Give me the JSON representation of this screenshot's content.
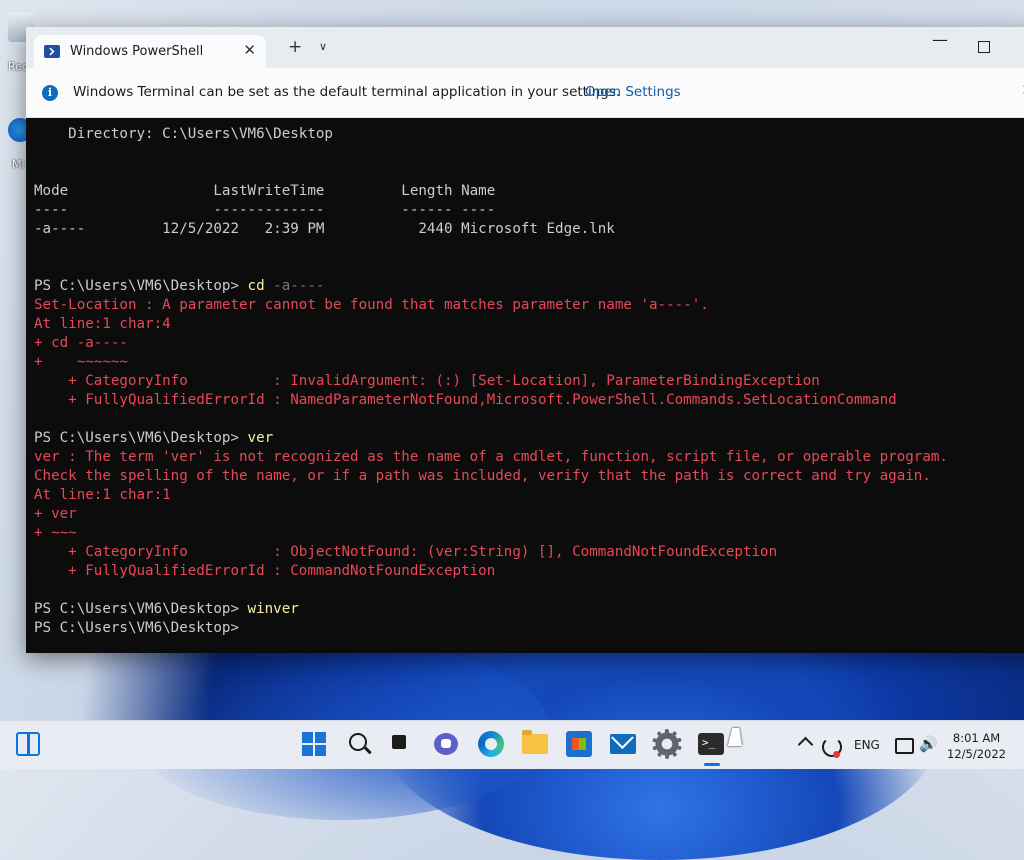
{
  "desktop": {
    "icons": [
      {
        "label": "Rec",
        "icon": "recycle-bin-icon"
      },
      {
        "label": "Mi",
        "icon": "edge-shortcut-icon"
      }
    ]
  },
  "window": {
    "tab_title": "Windows PowerShell",
    "tab_close": "✕",
    "new_tab": "+",
    "tab_dropdown": "∨",
    "minimize": "—",
    "close": "✕",
    "info_icon": "i",
    "info_text": "Windows Terminal can be set as the default terminal application in your settings.",
    "info_link": "Open Settings",
    "info_close": "✕"
  },
  "console": {
    "lines": [
      {
        "type": "out",
        "text": "    Directory: C:\\Users\\VM6\\Desktop"
      },
      {
        "type": "out",
        "text": ""
      },
      {
        "type": "out",
        "text": ""
      },
      {
        "type": "out",
        "text": "Mode                 LastWriteTime         Length Name"
      },
      {
        "type": "out",
        "text": "----                 -------------         ------ ----"
      },
      {
        "type": "out",
        "text": "-a----         12/5/2022   2:39 PM           2440 Microsoft Edge.lnk"
      },
      {
        "type": "out",
        "text": ""
      },
      {
        "type": "out",
        "text": ""
      },
      {
        "type": "prompt",
        "prompt": "PS C:\\Users\\VM6\\Desktop> ",
        "cmd": "cd",
        "arg": " -a----"
      },
      {
        "type": "err",
        "text": "Set-Location : A parameter cannot be found that matches parameter name 'a----'."
      },
      {
        "type": "err",
        "text": "At line:1 char:4"
      },
      {
        "type": "err",
        "text": "+ cd -a----"
      },
      {
        "type": "err",
        "text": "+    ~~~~~~"
      },
      {
        "type": "err",
        "text": "    + CategoryInfo          : InvalidArgument: (:) [Set-Location], ParameterBindingException"
      },
      {
        "type": "err",
        "text": "    + FullyQualifiedErrorId : NamedParameterNotFound,Microsoft.PowerShell.Commands.SetLocationCommand"
      },
      {
        "type": "out",
        "text": ""
      },
      {
        "type": "prompt",
        "prompt": "PS C:\\Users\\VM6\\Desktop> ",
        "cmd": "ver",
        "arg": ""
      },
      {
        "type": "err",
        "text": "ver : The term 'ver' is not recognized as the name of a cmdlet, function, script file, or operable program."
      },
      {
        "type": "err",
        "text": "Check the spelling of the name, or if a path was included, verify that the path is correct and try again."
      },
      {
        "type": "err",
        "text": "At line:1 char:1"
      },
      {
        "type": "err",
        "text": "+ ver"
      },
      {
        "type": "err",
        "text": "+ ~~~"
      },
      {
        "type": "err",
        "text": "    + CategoryInfo          : ObjectNotFound: (ver:String) [], CommandNotFoundException"
      },
      {
        "type": "err",
        "text": "    + FullyQualifiedErrorId : CommandNotFoundException"
      },
      {
        "type": "out",
        "text": ""
      },
      {
        "type": "prompt",
        "prompt": "PS C:\\Users\\VM6\\Desktop> ",
        "cmd": "winver",
        "arg": ""
      },
      {
        "type": "prompt",
        "prompt": "PS C:\\Users\\VM6\\Desktop>",
        "cmd": "",
        "arg": ""
      }
    ]
  },
  "taskbar": {
    "apps": [
      "widgets-icon",
      "start-icon",
      "search-icon",
      "task-view-icon",
      "chat-icon",
      "edge-icon",
      "file-explorer-icon",
      "store-icon",
      "mail-icon",
      "settings-icon",
      "terminal-icon"
    ],
    "tray": {
      "chevron": "show-hidden-icons",
      "lang": "ENG",
      "volume": "🔊",
      "time": "8:01 AM",
      "date": "12/5/2022"
    }
  }
}
